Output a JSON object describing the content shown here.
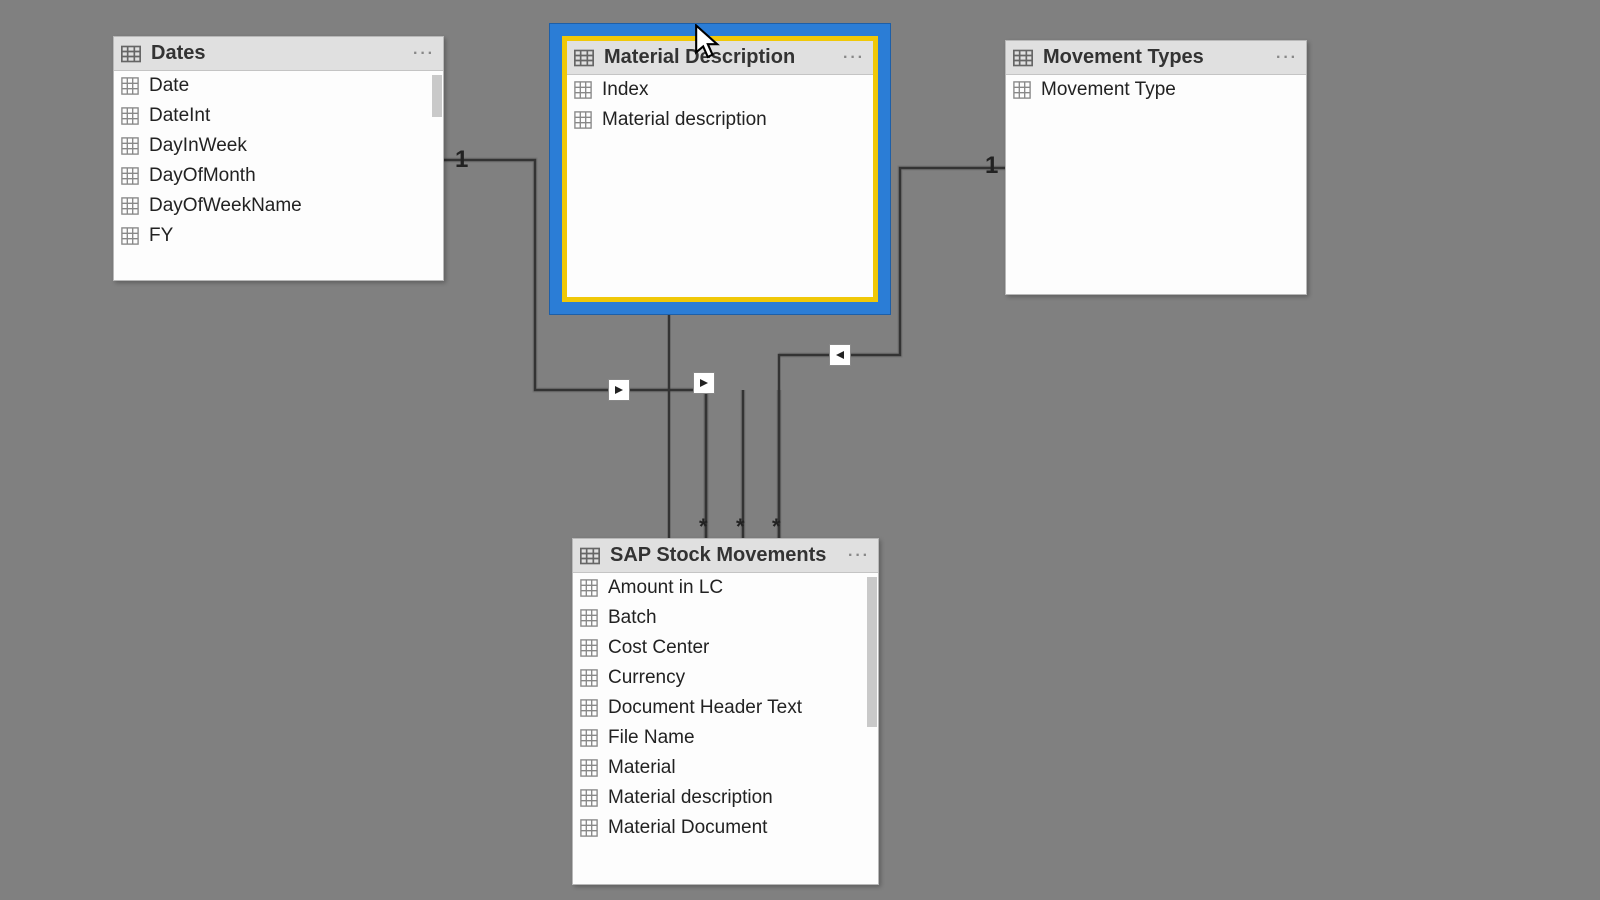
{
  "tables": {
    "dates": {
      "title": "Dates",
      "fields": [
        "Date",
        "DateInt",
        "DayInWeek",
        "DayOfMonth",
        "DayOfWeekName",
        "FY"
      ]
    },
    "material_description": {
      "title": "Material Description",
      "fields": [
        "Index",
        "Material description"
      ]
    },
    "movement_types": {
      "title": "Movement Types",
      "fields": [
        "Movement Type"
      ]
    },
    "sap_stock_movements": {
      "title": "SAP Stock Movements",
      "fields": [
        "Amount in LC",
        "Batch",
        "Cost Center",
        "Currency",
        "Document Header Text",
        "File Name",
        "Material",
        "Material description",
        "Material Document"
      ]
    }
  },
  "relationships": {
    "dates_card_label": "1",
    "movement_types_card_label": "1",
    "sap_star_1": "*",
    "sap_star_2": "*",
    "sap_star_3": "*"
  },
  "ui": {
    "more": "···"
  }
}
